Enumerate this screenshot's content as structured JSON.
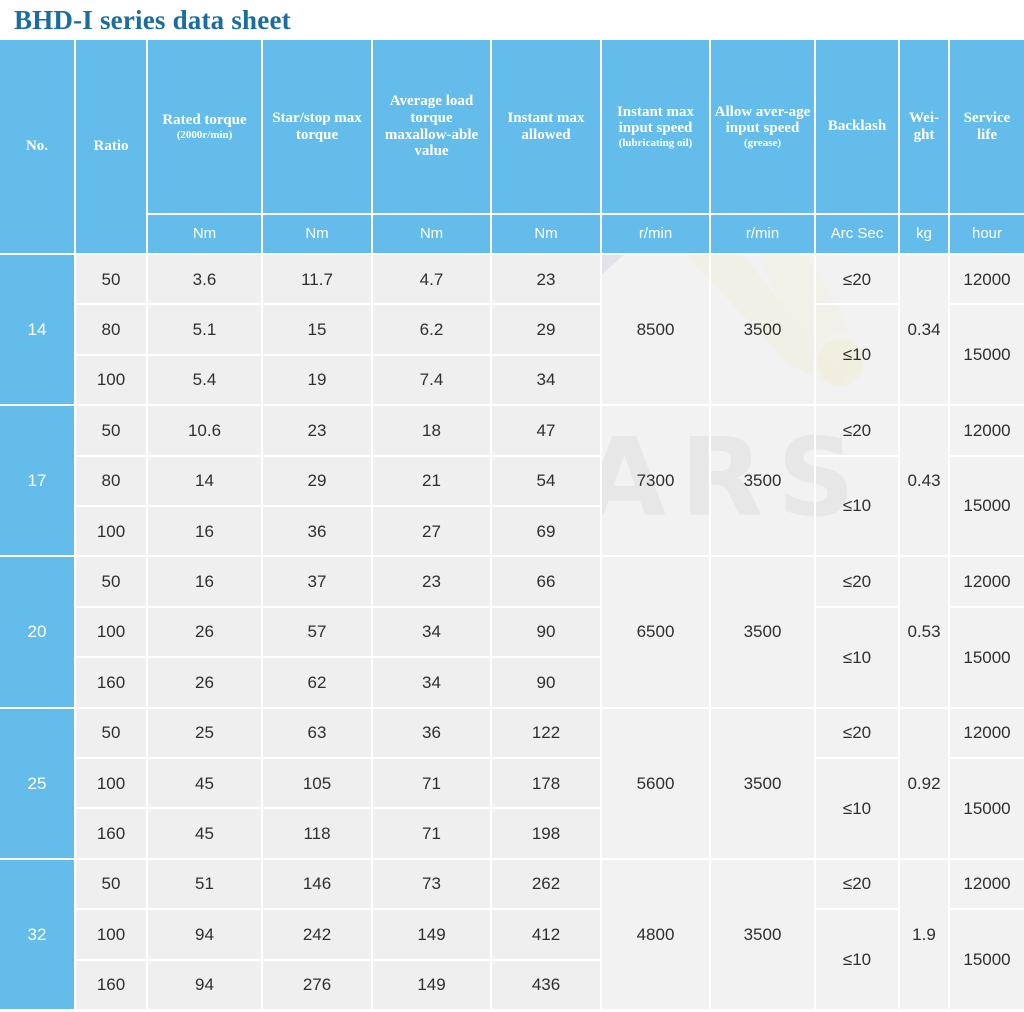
{
  "title": "BHD-I series data sheet",
  "watermark": "WOOLARS",
  "colors": {
    "header_blue": "#64bcea",
    "title_blue": "#1a6d9e",
    "data_bg": "#efefef",
    "grid_line": "#ffffff",
    "watermark_gray": "#c3c3c3"
  },
  "table": {
    "headers": [
      {
        "label": "No.",
        "unit": "",
        "name": "no"
      },
      {
        "label": "Ratio",
        "unit": "",
        "name": "ratio"
      },
      {
        "label": "Rated torque",
        "sub": "(2000r/min)",
        "unit": "Nm",
        "name": "rated-torque"
      },
      {
        "label": "Star/stop max torque",
        "unit": "Nm",
        "name": "start-stop-max-torque"
      },
      {
        "label": "Average load torque maxallow-able value",
        "unit": "Nm",
        "name": "average-load-torque"
      },
      {
        "label": "Instant max allowed",
        "unit": "Nm",
        "name": "instant-max-allowed"
      },
      {
        "label": "Instant max input speed",
        "sub": "(lubricating oil)",
        "unit": "r/min",
        "name": "instant-max-input-speed"
      },
      {
        "label": "Allow aver-age input speed",
        "sub": "(grease)",
        "unit": "r/min",
        "name": "allow-average-input-speed"
      },
      {
        "label": "Backlash",
        "unit": "Arc Sec",
        "name": "backlash"
      },
      {
        "label": "Wei-ght",
        "unit": "kg",
        "name": "weight"
      },
      {
        "label": "Service life",
        "unit": "hour",
        "name": "service-life"
      }
    ],
    "groups": [
      {
        "no": "14",
        "rows": [
          {
            "ratio": "50",
            "rated_torque": "3.6",
            "start_stop_max_torque": "11.7",
            "average_load_torque": "4.7",
            "instant_max_allowed": "23"
          },
          {
            "ratio": "80",
            "rated_torque": "5.1",
            "start_stop_max_torque": "15",
            "average_load_torque": "6.2",
            "instant_max_allowed": "29"
          },
          {
            "ratio": "100",
            "rated_torque": "5.4",
            "start_stop_max_torque": "19",
            "average_load_torque": "7.4",
            "instant_max_allowed": "34"
          }
        ],
        "instant_max_input_speed": "8500",
        "allow_average_input_speed": "3500",
        "backlash_top": "≤20",
        "backlash_bottom": "≤10",
        "weight": "0.34",
        "service_life_top": "12000",
        "service_life_bottom": "15000"
      },
      {
        "no": "17",
        "rows": [
          {
            "ratio": "50",
            "rated_torque": "10.6",
            "start_stop_max_torque": "23",
            "average_load_torque": "18",
            "instant_max_allowed": "47"
          },
          {
            "ratio": "80",
            "rated_torque": "14",
            "start_stop_max_torque": "29",
            "average_load_torque": "21",
            "instant_max_allowed": "54"
          },
          {
            "ratio": "100",
            "rated_torque": "16",
            "start_stop_max_torque": "36",
            "average_load_torque": "27",
            "instant_max_allowed": "69"
          }
        ],
        "instant_max_input_speed": "7300",
        "allow_average_input_speed": "3500",
        "backlash_top": "≤20",
        "backlash_bottom": "≤10",
        "weight": "0.43",
        "service_life_top": "12000",
        "service_life_bottom": "15000"
      },
      {
        "no": "20",
        "rows": [
          {
            "ratio": "50",
            "rated_torque": "16",
            "start_stop_max_torque": "37",
            "average_load_torque": "23",
            "instant_max_allowed": "66"
          },
          {
            "ratio": "100",
            "rated_torque": "26",
            "start_stop_max_torque": "57",
            "average_load_torque": "34",
            "instant_max_allowed": "90"
          },
          {
            "ratio": "160",
            "rated_torque": "26",
            "start_stop_max_torque": "62",
            "average_load_torque": "34",
            "instant_max_allowed": "90"
          }
        ],
        "instant_max_input_speed": "6500",
        "allow_average_input_speed": "3500",
        "backlash_top": "≤20",
        "backlash_bottom": "≤10",
        "weight": "0.53",
        "service_life_top": "12000",
        "service_life_bottom": "15000"
      },
      {
        "no": "25",
        "rows": [
          {
            "ratio": "50",
            "rated_torque": "25",
            "start_stop_max_torque": "63",
            "average_load_torque": "36",
            "instant_max_allowed": "122"
          },
          {
            "ratio": "100",
            "rated_torque": "45",
            "start_stop_max_torque": "105",
            "average_load_torque": "71",
            "instant_max_allowed": "178"
          },
          {
            "ratio": "160",
            "rated_torque": "45",
            "start_stop_max_torque": "118",
            "average_load_torque": "71",
            "instant_max_allowed": "198"
          }
        ],
        "instant_max_input_speed": "5600",
        "allow_average_input_speed": "3500",
        "backlash_top": "≤20",
        "backlash_bottom": "≤10",
        "weight": "0.92",
        "service_life_top": "12000",
        "service_life_bottom": "15000"
      },
      {
        "no": "32",
        "rows": [
          {
            "ratio": "50",
            "rated_torque": "51",
            "start_stop_max_torque": "146",
            "average_load_torque": "73",
            "instant_max_allowed": "262"
          },
          {
            "ratio": "100",
            "rated_torque": "94",
            "start_stop_max_torque": "242",
            "average_load_torque": "149",
            "instant_max_allowed": "412"
          },
          {
            "ratio": "160",
            "rated_torque": "94",
            "start_stop_max_torque": "276",
            "average_load_torque": "149",
            "instant_max_allowed": "436"
          }
        ],
        "instant_max_input_speed": "4800",
        "allow_average_input_speed": "3500",
        "backlash_top": "≤20",
        "backlash_bottom": "≤10",
        "weight": "1.9",
        "service_life_top": "12000",
        "service_life_bottom": "15000"
      }
    ]
  }
}
